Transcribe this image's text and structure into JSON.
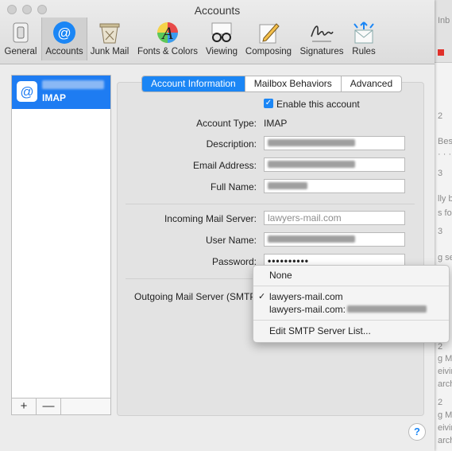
{
  "window": {
    "title": "Accounts"
  },
  "toolbar": {
    "items": [
      {
        "label": "General",
        "icon": "general-switch-icon"
      },
      {
        "label": "Accounts",
        "icon": "at-sign-icon"
      },
      {
        "label": "Junk Mail",
        "icon": "junk-mail-bin-icon"
      },
      {
        "label": "Fonts & Colors",
        "icon": "fonts-colors-icon"
      },
      {
        "label": "Viewing",
        "icon": "glasses-icon"
      },
      {
        "label": "Composing",
        "icon": "pencil-paper-icon"
      },
      {
        "label": "Signatures",
        "icon": "signature-icon"
      },
      {
        "label": "Rules",
        "icon": "rules-envelope-icon"
      }
    ],
    "selected": "Accounts"
  },
  "sidebar": {
    "account_type": "IMAP",
    "add_label": "+",
    "remove_label": "—"
  },
  "tabs": [
    "Account Information",
    "Mailbox Behaviors",
    "Advanced"
  ],
  "form": {
    "enable_label": "Enable this account",
    "enable_checked": true,
    "account_type_label": "Account Type:",
    "account_type_value": "IMAP",
    "description_label": "Description:",
    "email_label": "Email Address:",
    "fullname_label": "Full Name:",
    "incoming_label": "Incoming Mail Server:",
    "incoming_placeholder": "lawyers-mail.com",
    "username_label": "User Name:",
    "password_label": "Password:",
    "password_value": "••••••••••",
    "outgoing_label": "Outgoing Mail Server (SMTP"
  },
  "smtp_menu": {
    "none": "None",
    "server1": "lawyers-mail.com",
    "server2": "lawyers-mail.com:",
    "edit": "Edit SMTP Server List..."
  },
  "help_label": "?",
  "background_app": {
    "lines": [
      "Inb",
      "2",
      "Bes",
      "· · ·",
      "3",
      "lly b",
      "s fo",
      "3",
      "g se",
      "3",
      "2",
      "g Ma",
      "eivir",
      "arch",
      "2",
      "g Ma",
      "eivir",
      "arch"
    ]
  },
  "colors": {
    "accent": "#1b86f5",
    "selection": "#1e7cf2"
  }
}
